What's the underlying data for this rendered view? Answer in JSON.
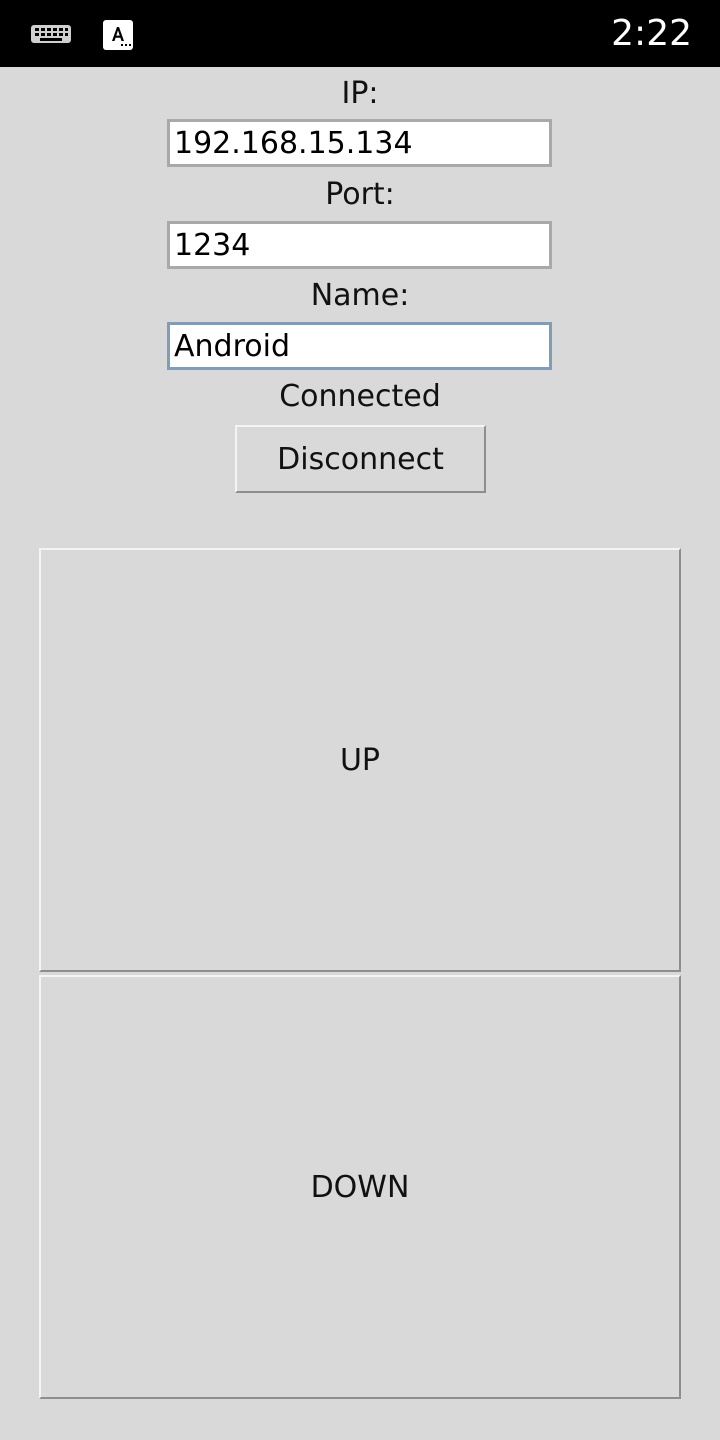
{
  "status_bar": {
    "time": "2:22",
    "icons": [
      "keyboard-icon",
      "text-input-icon"
    ]
  },
  "form": {
    "ip_label": "IP:",
    "ip_value": "192.168.15.134",
    "port_label": "Port:",
    "port_value": "1234",
    "name_label": "Name:",
    "name_value": "Android"
  },
  "connection": {
    "status": "Connected",
    "button_label": "Disconnect"
  },
  "controls": {
    "up_label": "UP",
    "down_label": "DOWN"
  },
  "colors": {
    "background": "#d9d9d9",
    "status_bar": "#000000",
    "field_border": "#a9a9a9",
    "focused_border": "#7f9db9"
  }
}
